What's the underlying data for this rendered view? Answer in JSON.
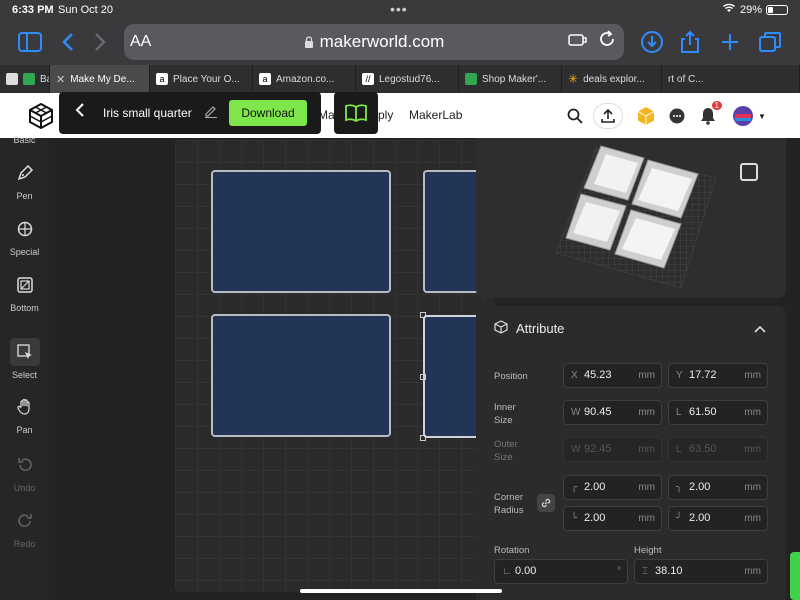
{
  "status": {
    "time": "6:33 PM",
    "date": "Sun Oct 20",
    "battery": "29%"
  },
  "browser": {
    "text_size_label": "AA",
    "url": "makerworld.com",
    "tabs": [
      {
        "label": "Bamb",
        "fav_color": "#2fa84f",
        "active": false
      },
      {
        "label": "Make My De...",
        "fav_color": "#9a9a9a",
        "active": true
      },
      {
        "label": "Place Your O...",
        "fav_color": "#ffffff",
        "active": false
      },
      {
        "label": "Amazon.co...",
        "fav_color": "#ffffff",
        "active": false
      },
      {
        "label": "Legostud76...",
        "fav_color": "#ffffff",
        "active": false
      },
      {
        "label": "Shop Maker'...",
        "fav_color": "#2fa84f",
        "active": false
      },
      {
        "label": "deals explor...",
        "fav_color": "#f5b400",
        "active": false
      },
      {
        "label": "rt of C...",
        "fav_color": "#555555",
        "active": false
      }
    ]
  },
  "header": {
    "nav_partial_1": "Ma",
    "nav_partial_2": "ply",
    "nav_makerlab": "MakerLab",
    "notification_count": "1"
  },
  "overlay": {
    "model_name": "Iris small quarter",
    "download_label": "Download"
  },
  "tools": [
    {
      "label": "Basic",
      "icon": "basic-icon"
    },
    {
      "label": "Pen",
      "icon": "pen-icon"
    },
    {
      "label": "Special",
      "icon": "special-icon"
    },
    {
      "label": "Bottom",
      "icon": "bottom-icon"
    },
    {
      "label": "Select",
      "icon": "select-icon"
    },
    {
      "label": "Pan",
      "icon": "pan-icon"
    },
    {
      "label": "Undo",
      "icon": "undo-icon"
    },
    {
      "label": "Redo",
      "icon": "redo-icon"
    }
  ],
  "attribute": {
    "title": "Attribute",
    "position_label": "Position",
    "position_x": "45.23",
    "position_y": "17.72",
    "inner_size_label": "Inner\nSize",
    "inner_w": "90.45",
    "inner_l": "61.50",
    "outer_size_label": "Outer\nSize",
    "outer_w": "92.45",
    "outer_l": "63.50",
    "corner_radius_label": "Corner\nRadius",
    "radius_tl": "2.00",
    "radius_tr": "2.00",
    "radius_bl": "2.00",
    "radius_br": "2.00",
    "rotation_label": "Rotation",
    "rotation_value": "0.00",
    "rotation_unit": "°",
    "height_label": "Height",
    "height_value": "38.10",
    "unit": "mm",
    "x_prefix": "X",
    "y_prefix": "Y",
    "w_prefix": "W",
    "l_prefix": "L"
  },
  "colors": {
    "accent_green": "#7ee54a",
    "safari_blue": "#2f8cff",
    "slot_fill": "#233556"
  }
}
